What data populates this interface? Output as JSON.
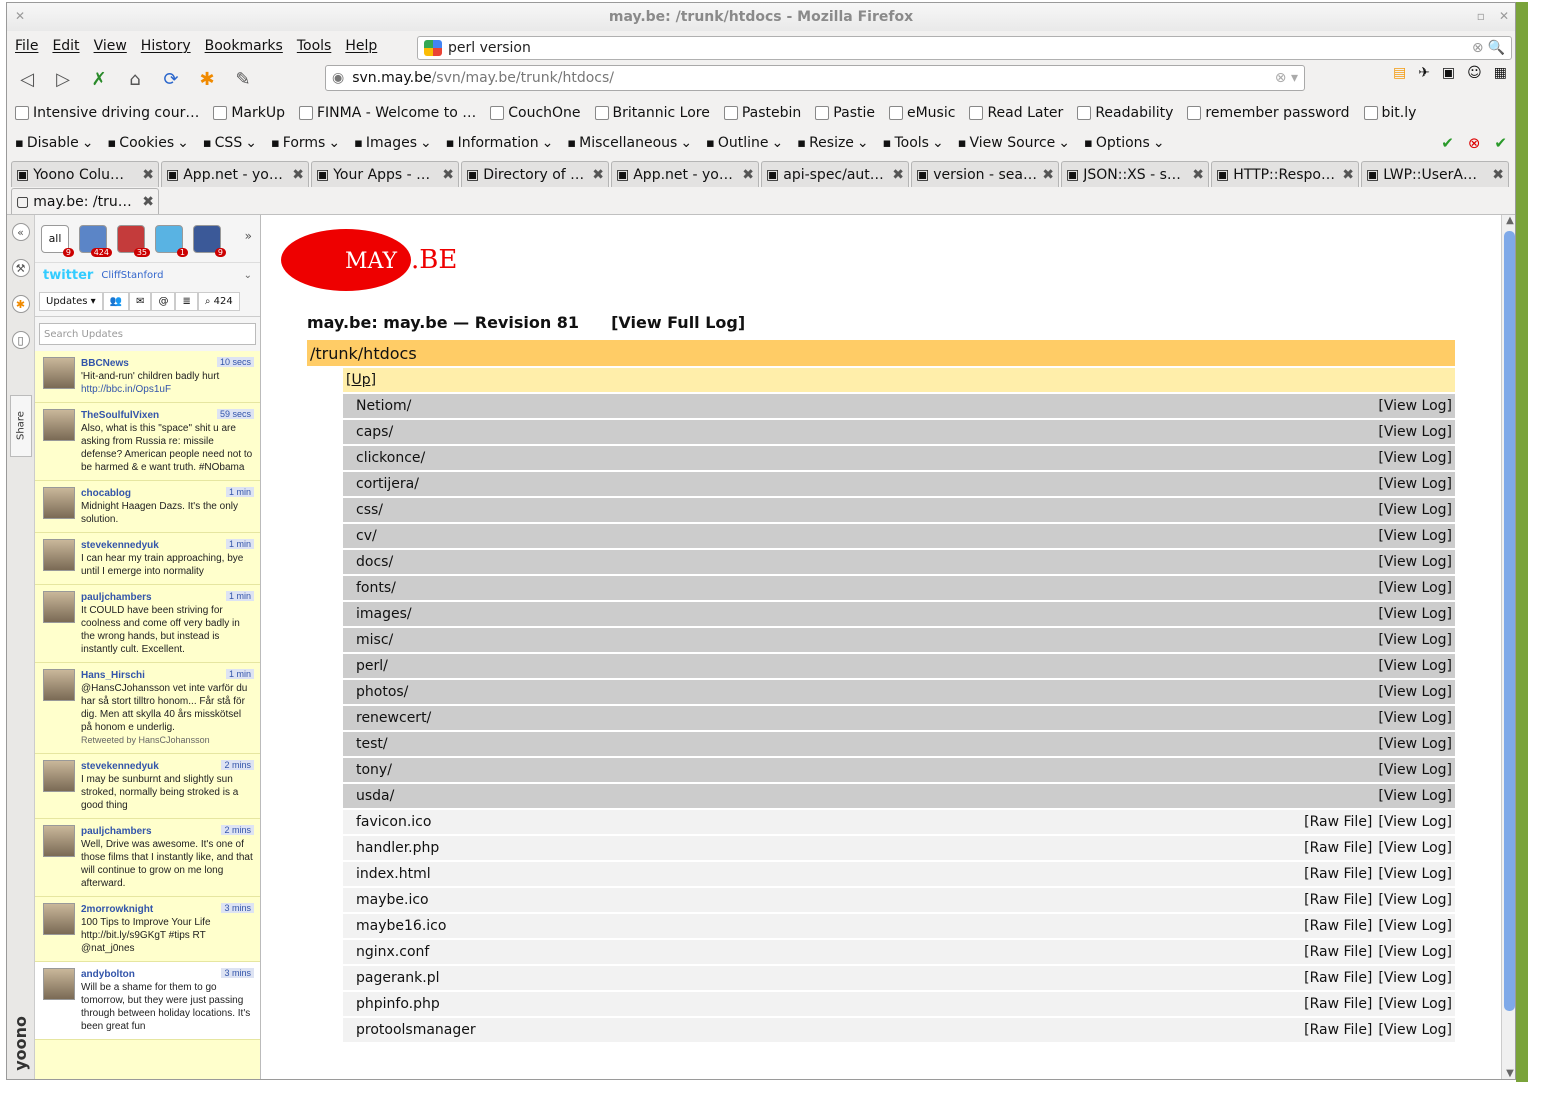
{
  "window": {
    "title": "may.be: /trunk/htdocs - Mozilla Firefox"
  },
  "menubar": {
    "items": [
      "File",
      "Edit",
      "View",
      "History",
      "Bookmarks",
      "Tools",
      "Help"
    ]
  },
  "search": {
    "value": "perl version"
  },
  "urlbar": {
    "host": "svn.may.be",
    "path": "/svn/may.be/trunk/htdocs/"
  },
  "bookmarks": [
    "Intensive driving cour…",
    "MarkUp",
    "FINMA - Welcome to …",
    "CouchOne",
    "Britannic Lore",
    "Pastebin",
    "Pastie",
    "eMusic",
    "Read Later",
    "Readability",
    "remember password",
    "bit.ly"
  ],
  "webdev": [
    "Disable",
    "Cookies",
    "CSS",
    "Forms",
    "Images",
    "Information",
    "Miscellaneous",
    "Outline",
    "Resize",
    "Tools",
    "View Source",
    "Options"
  ],
  "tabs_row1": [
    "Yoono Colu…",
    "App.net - yo…",
    "Your Apps - …",
    "Directory of …",
    "App.net - yo…",
    "api-spec/aut…",
    "version - sea…",
    "JSON::XS - s…",
    "HTTP::Respo…",
    "LWP::UserA…"
  ],
  "active_tab": "may.be: /tru…",
  "yoono": {
    "accounts": [
      {
        "label": "all",
        "badge": "9"
      },
      {
        "label": "",
        "badge": "424"
      },
      {
        "label": "",
        "badge": "35"
      },
      {
        "label": "",
        "badge": "1"
      },
      {
        "label": "",
        "badge": "9"
      }
    ],
    "network": "twitter",
    "username": "CliffStanford",
    "tabs": [
      "Updates",
      "424"
    ],
    "search_placeholder": "Search Updates",
    "tweets": [
      {
        "name": "BBCNews",
        "time": "10 secs",
        "text": "'Hit-and-run' children badly hurt",
        "link": "http://bbc.in/Ops1uF",
        "extra": ""
      },
      {
        "name": "TheSoulfulVixen",
        "time": "59 secs",
        "text": "Also, what is this \"space\" shit u are asking from Russia re: missile defense? American people need not to be harmed & e want truth. #NObama",
        "link": "",
        "extra": ""
      },
      {
        "name": "chocablog",
        "time": "1 min",
        "text": "Midnight Haagen Dazs. It's the only solution.",
        "link": "",
        "extra": ""
      },
      {
        "name": "stevekennedyuk",
        "time": "1 min",
        "text": "I can hear my train approaching, bye until I emerge into normality",
        "link": "",
        "extra": ""
      },
      {
        "name": "pauljchambers",
        "time": "1 min",
        "text": "It COULD have been striving for coolness and come off very badly in the wrong hands, but instead is instantly cult. Excellent.",
        "link": "",
        "extra": ""
      },
      {
        "name": "Hans_Hirschi",
        "time": "1 min",
        "text": "@HansCJohansson vet inte varför du har så stort tilltro honom... Får stå för dig. Men att skylla 40 års misskötsel på honom e underlig.",
        "link": "",
        "extra": "Retweeted by HansCJohansson"
      },
      {
        "name": "stevekennedyuk",
        "time": "2 mins",
        "text": "I may be sunburnt and slightly sun stroked, normally being stroked is a good thing",
        "link": "",
        "extra": ""
      },
      {
        "name": "pauljchambers",
        "time": "2 mins",
        "text": "Well, Drive was awesome. It's one of those films that I instantly like, and that will continue to grow on me long afterward.",
        "link": "",
        "extra": ""
      },
      {
        "name": "2morrowknight",
        "time": "3 mins",
        "text": "100 Tips to Improve Your Life http://bit.ly/s9GKgT #tips RT @nat_j0nes",
        "link": "",
        "extra": ""
      },
      {
        "name": "andybolton",
        "time": "3 mins",
        "text": "Will be a shame for them to go tomorrow, but they were just passing through between holiday locations. It's been great fun",
        "link": "",
        "extra": ""
      }
    ],
    "share_label": "Share",
    "brand": "yoono"
  },
  "page": {
    "logo_left": "MAY",
    "logo_right": ".BE",
    "heading": "may.be:  may.be — Revision 81",
    "full_log": "[View Full Log]",
    "path": "/trunk/htdocs",
    "up_label": "[Up]",
    "view_log": "[View Log]",
    "raw_file": "[Raw File]",
    "dirs": [
      "Netiom/",
      "caps/",
      "clickonce/",
      "cortijera/",
      "css/",
      "cv/",
      "docs/",
      "fonts/",
      "images/",
      "misc/",
      "perl/",
      "photos/",
      "renewcert/",
      "test/",
      "tony/",
      "usda/"
    ],
    "files": [
      "favicon.ico",
      "handler.php",
      "index.html",
      "maybe.ico",
      "maybe16.ico",
      "nginx.conf",
      "pagerank.pl",
      "phpinfo.php",
      "protoolsmanager"
    ]
  }
}
